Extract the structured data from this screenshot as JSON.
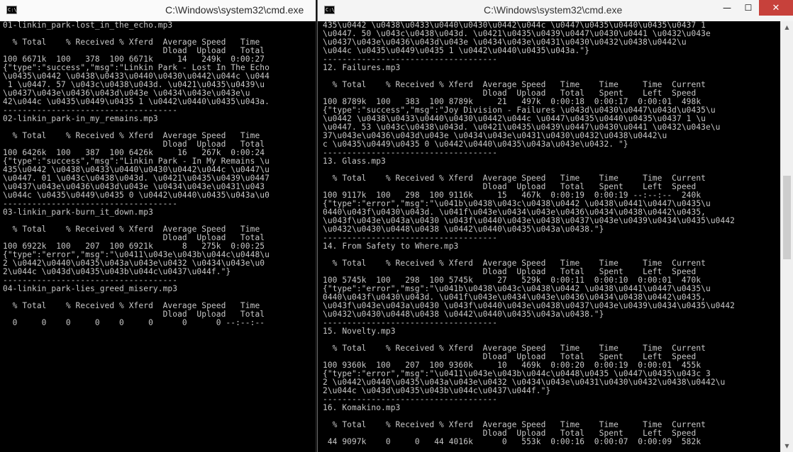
{
  "left_window": {
    "title": "C:\\Windows\\system32\\cmd.exe",
    "icon": "C:\\.",
    "lines": [
      "01-linkin_park-lost_in_the_echo.mp3",
      "",
      "  % Total    % Received % Xferd  Average Speed   Time",
      "                                 Dload  Upload   Total",
      "100 6671k  100   378  100 6671k     14   249k  0:00:27",
      "{\"type\":\"success\",\"msg\":\"Linkin Park - Lost In The Echo",
      "\\u0435\\u0442 \\u0438\\u0433\\u0440\\u0430\\u0442\\u044c \\u044",
      " 1 \\u0447. 57 \\u043c\\u0438\\u043d. \\u0421\\u0435\\u0439\\u",
      "\\u0437\\u043e\\u0436\\u043d\\u043e \\u0434\\u043e\\u043e\\u",
      "42\\u044c \\u0435\\u0449\\u0435 1 \\u0442\\u0440\\u0435\\u043a.",
      "------------------------------------",
      "02-linkin_park-in_my_remains.mp3",
      "",
      "  % Total    % Received % Xferd  Average Speed   Time",
      "                                 Dload  Upload   Total",
      "100 6426k  100   387  100 6426k     16   267k  0:00:24",
      "{\"type\":\"success\",\"msg\":\"Linkin Park - In My Remains \\u",
      "435\\u0442 \\u0438\\u0433\\u0440\\u0430\\u0442\\u044c \\u0447\\u",
      "\\u0447. 01 \\u043c\\u0438\\u043d. \\u0421\\u0435\\u0439\\u0447",
      "\\u0437\\u043e\\u0436\\u043d\\u043e \\u0434\\u043e\\u0431\\u043",
      "\\u044c \\u0435\\u0449\\u0435 0 \\u0442\\u0440\\u0435\\u043a\\u0",
      "------------------------------------",
      "03-linkin_park-burn_it_down.mp3",
      "",
      "  % Total    % Received % Xferd  Average Speed   Time",
      "                                 Dload  Upload   Total",
      "100 6922k  100   207  100 6921k      8   275k  0:00:25",
      "{\"type\":\"error\",\"msg\":\"\\u0411\\u043e\\u043b\\u044c\\u0448\\u",
      "2 \\u0442\\u0440\\u0435\\u043a\\u043e\\u0432 \\u0434\\u043e\\u0",
      "2\\u044c \\u043d\\u0435\\u043b\\u044c\\u0437\\u044f.\"}",
      "------------------------------------",
      "04-linkin_park-lies_greed_misery.mp3",
      "",
      "  % Total    % Received % Xferd  Average Speed   Time",
      "                                 Dload  Upload   Total",
      "  0     0    0     0    0     0      0      0 --:--:--"
    ]
  },
  "right_window": {
    "title": "C:\\Windows\\system32\\cmd.exe",
    "icon": "C:\\.",
    "buttons": {
      "minimize": "—",
      "maximize": "☐",
      "close": "✕"
    },
    "lines": [
      "435\\u0442 \\u0438\\u0433\\u0440\\u0430\\u0442\\u044c \\u0447\\u0435\\u0440\\u0435\\u0437 1",
      "\\u0447. 50 \\u043c\\u0438\\u043d. \\u0421\\u0435\\u0439\\u0447\\u0430\\u0441 \\u0432\\u043e",
      "\\u0437\\u043e\\u0436\\u043d\\u043e \\u0434\\u043e\\u0431\\u0430\\u0432\\u0438\\u0442\\u",
      "\\u044c \\u0435\\u0449\\u0435 1 \\u0442\\u0440\\u0435\\u043a.\"}",
      "------------------------------------",
      "12. Failures.mp3",
      "",
      "  % Total    % Received % Xferd  Average Speed   Time    Time     Time  Current",
      "                                 Dload  Upload   Total   Spent    Left  Speed",
      "100 8789k  100   383  100 8789k     21   497k  0:00:18  0:00:17  0:00:01  498k",
      "{\"type\":\"success\",\"msg\":\"Joy Division - Failures \\u043d\\u0430\\u0447\\u043d\\u0435\\u",
      "\\u0442 \\u0438\\u0433\\u0440\\u0430\\u0442\\u044c \\u0447\\u0435\\u0440\\u0435\\u0437 1 \\u",
      "\\u0447. 53 \\u043c\\u0438\\u043d. \\u0421\\u0435\\u0439\\u0447\\u0430\\u0441 \\u0432\\u043e\\u",
      "37\\u043e\\u0436\\u043d\\u043e \\u0434\\u043e\\u0431\\u0430\\u0432\\u0438\\u0442\\u",
      "c \\u0435\\u0449\\u0435 0 \\u0442\\u0440\\u0435\\u043a\\u043e\\u0432. \"}",
      "------------------------------------",
      "13. Glass.mp3",
      "",
      "  % Total    % Received % Xferd  Average Speed   Time    Time     Time  Current",
      "                                 Dload  Upload   Total   Spent    Left  Speed",
      "100 9117k  100   298  100 9116k     15   467k  0:00:19  0:00:19 --:--:--  240k",
      "{\"type\":\"error\",\"msg\":\"\\u041b\\u0438\\u043c\\u0438\\u0442 \\u0438\\u0441\\u0447\\u0435\\u",
      "0440\\u043f\\u0430\\u043d. \\u041f\\u043e\\u0434\\u043e\\u0436\\u0434\\u0438\\u0442\\u0435,",
      "\\u043f\\u043e\\u043a\\u0430 \\u043f\\u0440\\u043e\\u0438\\u0437\\u043e\\u0439\\u0434\\u0435\\u0442",
      "\\u0432\\u0430\\u0448\\u0438 \\u0442\\u0440\\u0435\\u043a\\u0438.\"}",
      "------------------------------------",
      "14. From Safety to Where.mp3",
      "",
      "  % Total    % Received % Xferd  Average Speed   Time    Time     Time  Current",
      "                                 Dload  Upload   Total   Spent    Left  Speed",
      "100 5745k  100   298  100 5745k     27   529k  0:00:11  0:00:10  0:00:01  470k",
      "{\"type\":\"error\",\"msg\":\"\\u041b\\u0438\\u043c\\u0438\\u0442 \\u0438\\u0441\\u0447\\u0435\\u",
      "0440\\u043f\\u0430\\u043d. \\u041f\\u043e\\u0434\\u043e\\u0436\\u0434\\u0438\\u0442\\u0435,",
      "\\u043f\\u043e\\u043a\\u0430 \\u043f\\u0440\\u043e\\u0438\\u0437\\u043e\\u0439\\u0434\\u0435\\u0442",
      "\\u0432\\u0430\\u0448\\u0438 \\u0442\\u0440\\u0435\\u043a\\u0438.\"}",
      "------------------------------------",
      "15. Novelty.mp3",
      "",
      "  % Total    % Received % Xferd  Average Speed   Time    Time     Time  Current",
      "                                 Dload  Upload   Total   Spent    Left  Speed",
      "100 9360k  100   207  100 9360k     10   469k  0:00:20  0:00:19  0:00:01  455k",
      "{\"type\":\"error\",\"msg\":\"\\u0411\\u043e\\u043b\\u044c\\u0448\\u0435 \\u0447\\u0435\\u043c 3",
      "2 \\u0442\\u0440\\u0435\\u043a\\u043e\\u0432 \\u0434\\u043e\\u0431\\u0430\\u0432\\u0438\\u0442\\u",
      "2\\u044c \\u043d\\u0435\\u043b\\u044c\\u0437\\u044f.\"}",
      "------------------------------------",
      "16. Komakino.mp3",
      "",
      "  % Total    % Received % Xferd  Average Speed   Time    Time     Time  Current",
      "                                 Dload  Upload   Total   Spent    Left  Speed",
      " 44 9097k    0     0   44 4016k      0   553k  0:00:16  0:00:07  0:00:09  582k"
    ]
  }
}
